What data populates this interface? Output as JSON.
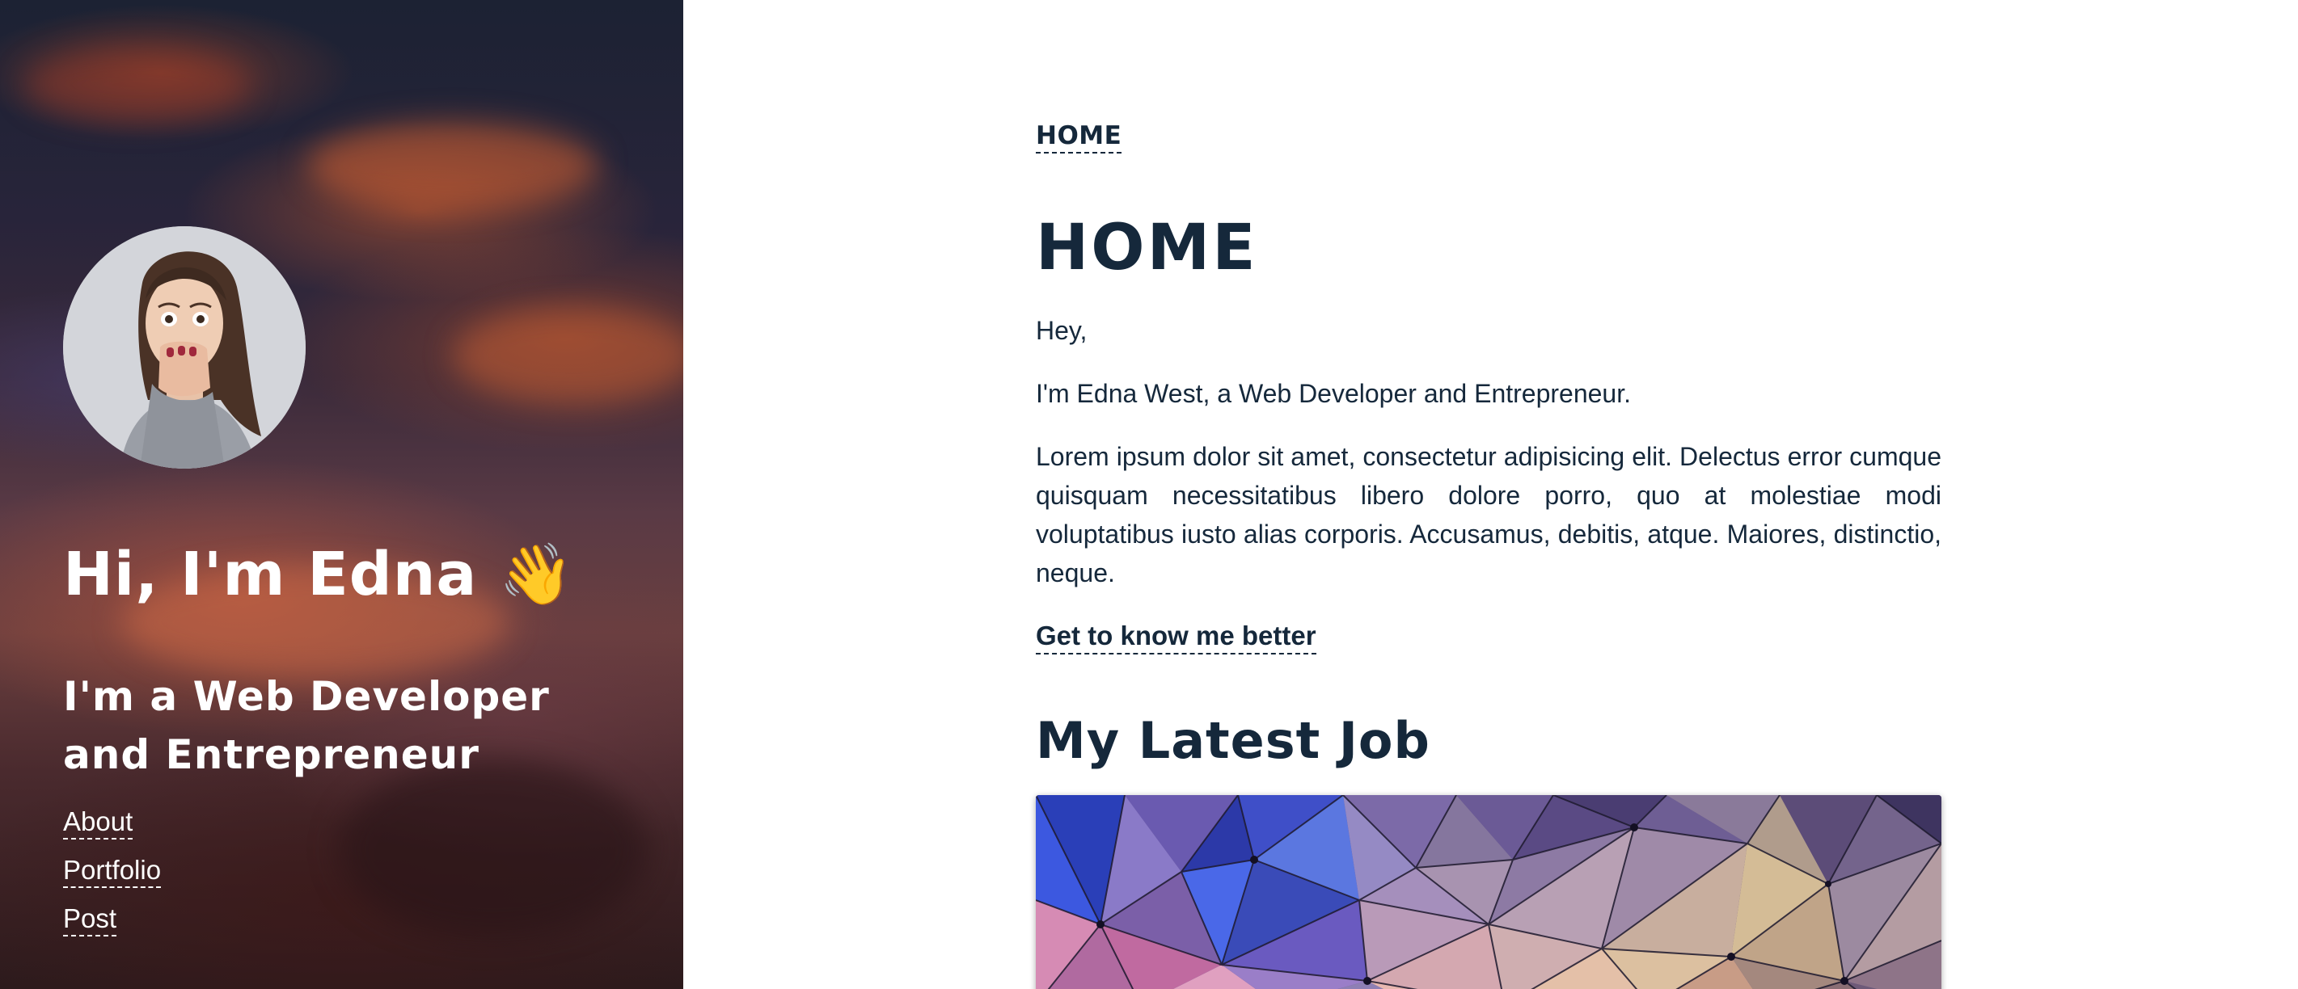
{
  "sidebar": {
    "avatar_alt": "Edna West profile photo",
    "greeting": "Hi, I'm Edna 👋",
    "subtitle": "I'm a Web Developer and Entrepreneur",
    "nav": [
      {
        "label": "About"
      },
      {
        "label": "Portfolio"
      },
      {
        "label": "Post"
      }
    ]
  },
  "main": {
    "breadcrumb": "HOME",
    "title": "HOME",
    "paragraphs": [
      "Hey,",
      "I'm Edna West, a Web Developer and Entrepreneur.",
      "Lorem ipsum dolor sit amet, consectetur adipisicing elit. Delectus error cumque quisquam necessitatibus libero dolore porro, quo at molestiae modi voluptatibus iusto alias corporis. Accusamus, debitis, atque. Maiores, distinctio, neque."
    ],
    "cta_link": "Get to know me better",
    "section_title": "My Latest Job"
  },
  "colors": {
    "text_primary": "#15283b",
    "sidebar_text": "#ffffff",
    "background": "#ffffff"
  }
}
